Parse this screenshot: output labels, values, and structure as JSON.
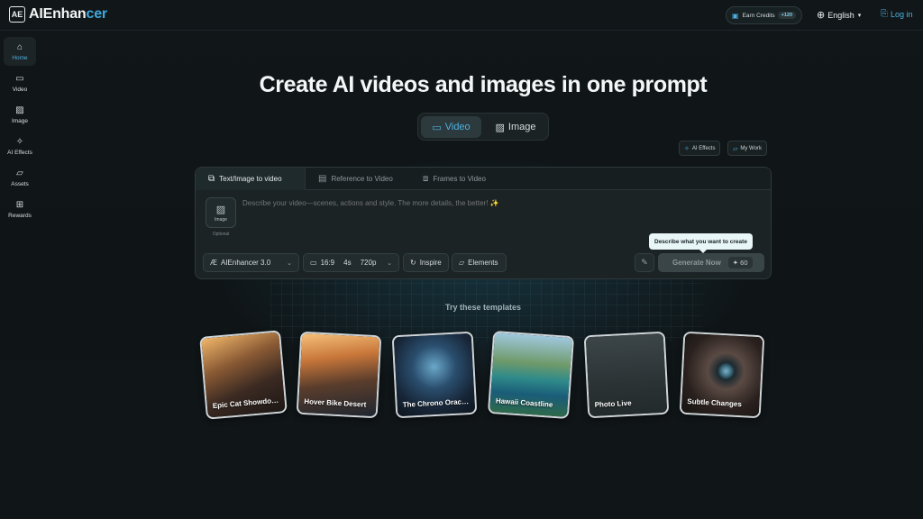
{
  "header": {
    "logo_mark": "AE",
    "logo_text_a": "AI",
    "logo_text_b": "Enhan",
    "logo_text_c": "cer",
    "earn_label": "Earn Credits",
    "earn_plus": "+120",
    "language": "English",
    "login": "Log in"
  },
  "sidebar": {
    "items": [
      {
        "label": "Home",
        "icon": "home-icon"
      },
      {
        "label": "Video",
        "icon": "video-icon"
      },
      {
        "label": "Image",
        "icon": "image-icon"
      },
      {
        "label": "AI Effects",
        "icon": "magic-wand-icon"
      },
      {
        "label": "Assets",
        "icon": "folder-icon"
      },
      {
        "label": "Rewards",
        "icon": "gift-icon"
      }
    ]
  },
  "hero": {
    "title": "Create AI videos and images in one prompt"
  },
  "mode_switch": {
    "video": "Video",
    "image": "Image",
    "selected": "Video"
  },
  "chips": {
    "ai_effects": "AI Effects",
    "my_work": "My Work"
  },
  "panel": {
    "tabs": [
      "Text/Image to video",
      "Reference to Video",
      "Frames to Video"
    ],
    "active_tab": "Text/Image to video",
    "upload_label": "Image",
    "optional": "Optional",
    "prompt_placeholder": "Describe your video—scenes, actions and style. The more details, the better! ✨",
    "model": "AIEnhancer 3.0",
    "ratio": "16:9",
    "duration": "4s",
    "resolution": "720p",
    "inspire": "Inspire",
    "elements": "Elements",
    "generate": "Generate Now",
    "cost": "60",
    "tooltip": "Describe what you want to create"
  },
  "templates": {
    "heading": "Try these templates",
    "items": [
      "Epic Cat Showdo…",
      "Hover Bike Desert",
      "The Chrono Orac…",
      "Hawaii Coastline",
      "Photo Live",
      "Subtle Changes"
    ]
  },
  "colors": {
    "accent": "#4fb0e0",
    "background": "#0f1416",
    "panel": "#1b2325"
  }
}
